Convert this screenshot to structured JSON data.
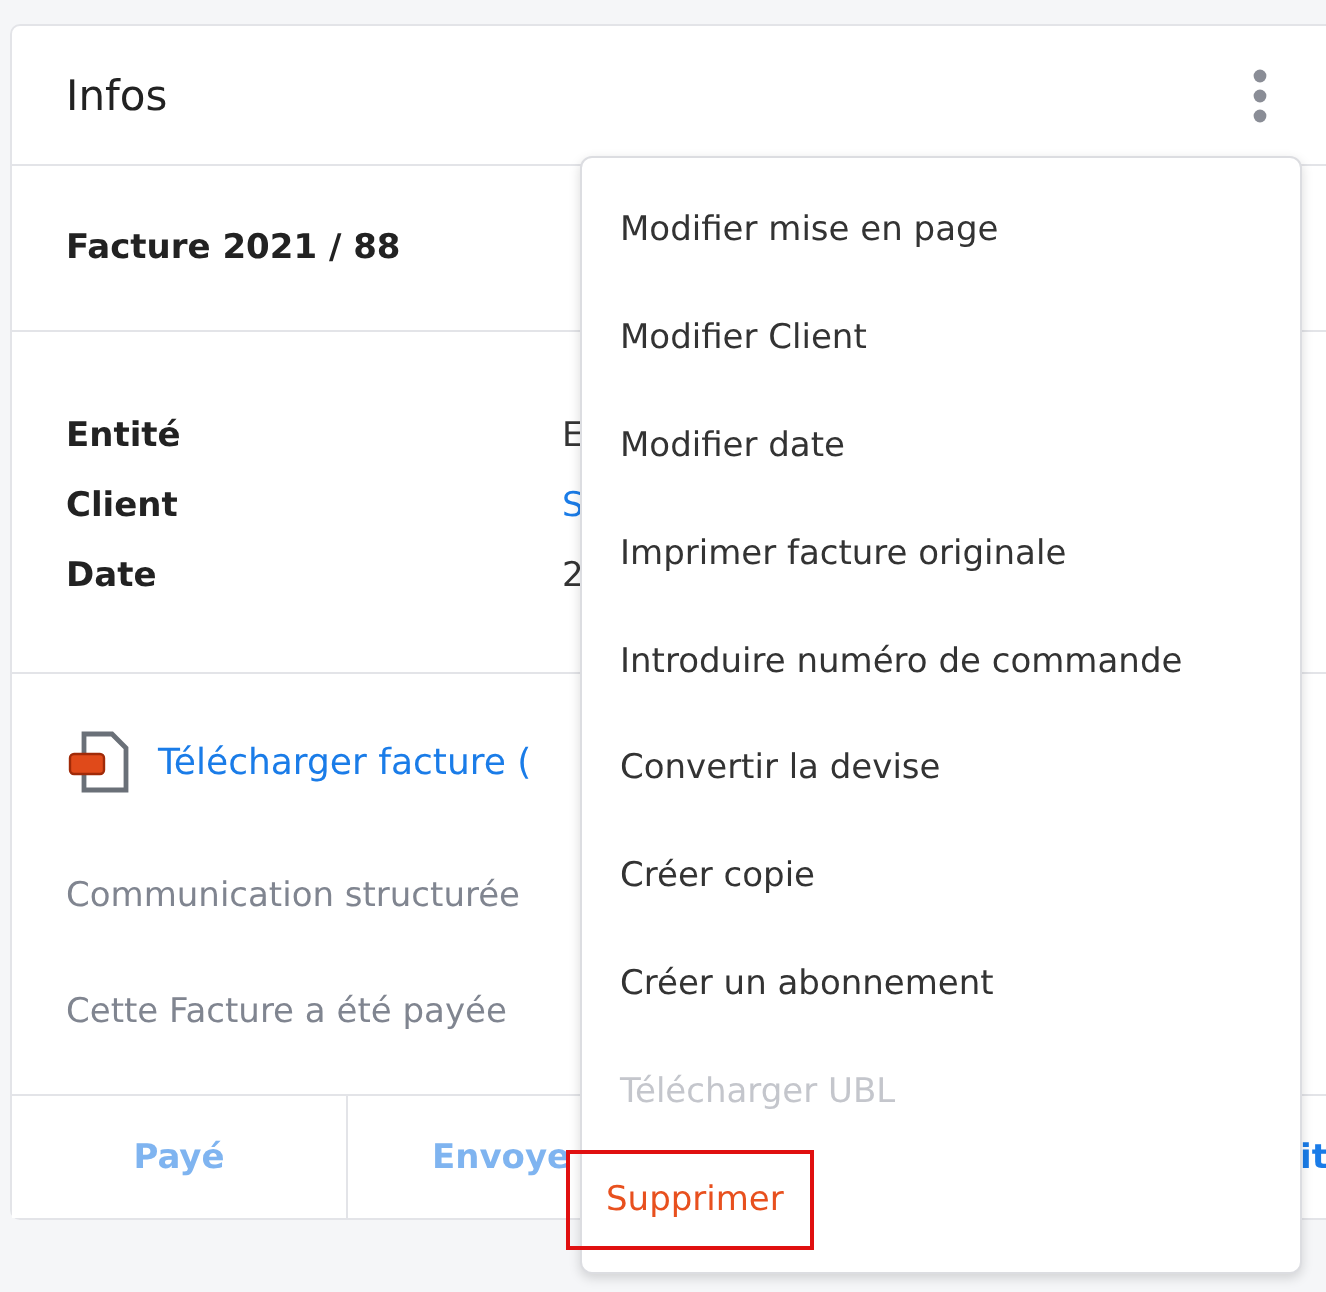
{
  "card": {
    "title": "Infos",
    "invoice": "Facture 2021 / 88",
    "details": [
      {
        "label": "Entité",
        "value": "E",
        "link": false
      },
      {
        "label": "Client",
        "value": "S",
        "link": true
      },
      {
        "label": "Date",
        "value": "2",
        "link": false
      }
    ],
    "download_link": "Télécharger facture (",
    "notes": [
      "Communication structurée",
      "Cette Facture a été payée"
    ],
    "actions": [
      "Payé",
      "Envoye",
      "it"
    ]
  },
  "menu": {
    "items": [
      {
        "label": "Modifier mise en page",
        "disabled": false,
        "danger": false,
        "highlighted": false
      },
      {
        "label": "Modifier Client",
        "disabled": false,
        "danger": false,
        "highlighted": false
      },
      {
        "label": "Modifier date",
        "disabled": false,
        "danger": false,
        "highlighted": false
      },
      {
        "label": "Imprimer facture originale",
        "disabled": false,
        "danger": false,
        "highlighted": false
      },
      {
        "label": "Introduire numéro de commande",
        "disabled": false,
        "danger": false,
        "highlighted": false
      },
      {
        "label": "Convertir la devise",
        "disabled": false,
        "danger": false,
        "highlighted": false
      },
      {
        "label": "Créer copie",
        "disabled": false,
        "danger": false,
        "highlighted": false
      },
      {
        "label": "Créer un abonnement",
        "disabled": false,
        "danger": false,
        "highlighted": false
      },
      {
        "label": "Télécharger UBL",
        "disabled": true,
        "danger": false,
        "highlighted": false
      },
      {
        "label": "Supprimer",
        "disabled": false,
        "danger": true,
        "highlighted": true
      }
    ]
  }
}
